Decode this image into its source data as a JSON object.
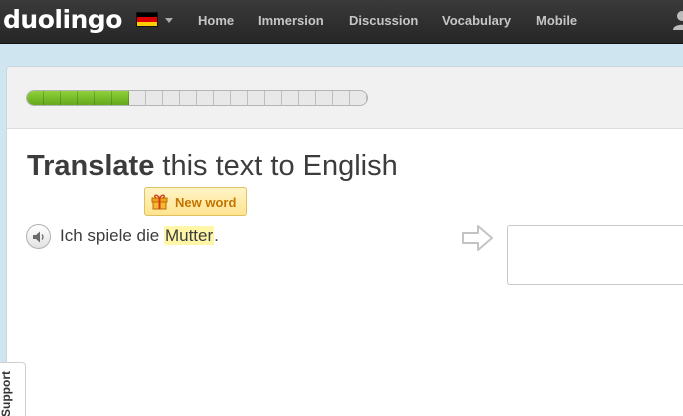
{
  "header": {
    "logo": "duolingo",
    "language_flag": "german-flag-icon",
    "nav": [
      "Home",
      "Immersion",
      "Discussion",
      "Vocabulary",
      "Mobile"
    ],
    "user_icon": "user-icon"
  },
  "progress": {
    "completed_segments": 6,
    "total_segments": 20
  },
  "exercise": {
    "title_bold": "Translate",
    "title_rest": " this text to English",
    "badge_label": "New word",
    "badge_icon": "gift-icon",
    "sentence_before": "Ich spiele die ",
    "sentence_highlight": "Mutter",
    "sentence_after": ".",
    "answer_value": "",
    "arrow_icon": "right-arrow-icon",
    "speaker_icon": "speaker-icon"
  },
  "support": {
    "label": "Support"
  },
  "colors": {
    "topbar": "#2f2f2f",
    "progress_green": "#78bd2a",
    "badge_text": "#c47400",
    "highlight": "#fff6a8"
  }
}
